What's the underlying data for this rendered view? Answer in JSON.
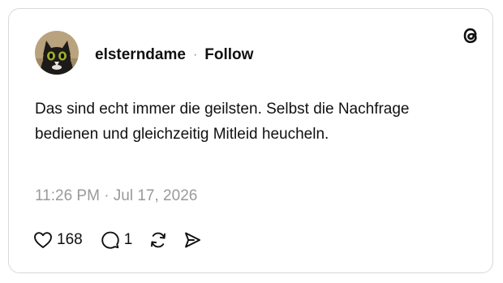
{
  "post": {
    "username": "elsterndame",
    "separator": "·",
    "follow_label": "Follow",
    "text": "Das sind echt immer die geilsten. Selbst die Nachfrage bedienen und gleichzeitig Mitleid heucheln.",
    "timestamp": "11:26 PM · Jul 17, 2026"
  },
  "actions": {
    "like_count": "168",
    "reply_count": "1"
  },
  "icons": {
    "brand": "threads-logo-icon",
    "like": "heart-icon",
    "reply": "speech-bubble-icon",
    "repost": "repost-icon",
    "share": "send-icon"
  },
  "colors": {
    "text": "#101010",
    "muted": "#9a9a9a",
    "border": "#d9d9d9"
  }
}
